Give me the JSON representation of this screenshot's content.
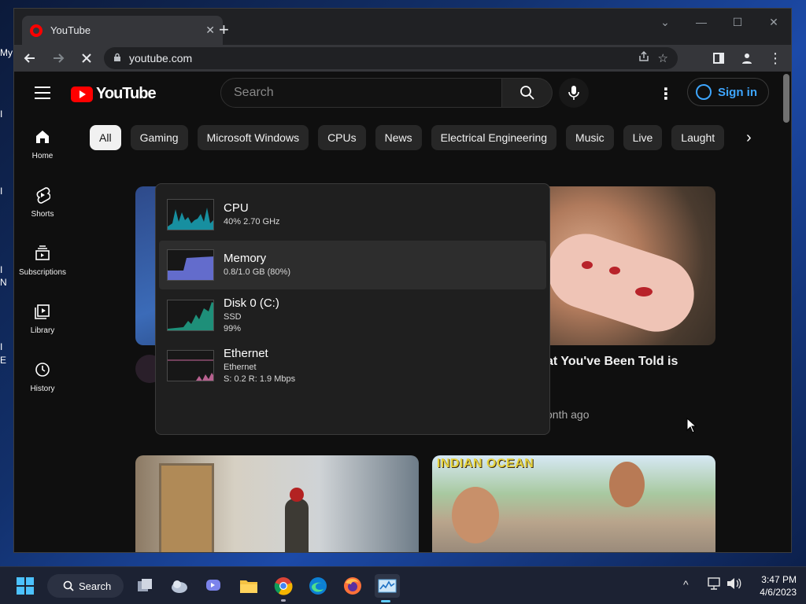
{
  "desktop": {
    "fragments": [
      "My",
      "I",
      "I",
      "I",
      "N",
      "I",
      "E"
    ]
  },
  "browser": {
    "tab_title": "YouTube",
    "tab_close": "✕",
    "new_tab": "+",
    "window_controls": [
      "⌄",
      "—",
      "☐",
      "✕"
    ],
    "url": "youtube.com"
  },
  "youtube": {
    "logo_text": "YouTube",
    "search_placeholder": "Search",
    "signin_label": "Sign in",
    "sidebar": [
      {
        "label": "Home",
        "icon": "home-icon"
      },
      {
        "label": "Shorts",
        "icon": "shorts-icon"
      },
      {
        "label": "Subscriptions",
        "icon": "subscriptions-icon"
      },
      {
        "label": "Library",
        "icon": "library-icon"
      },
      {
        "label": "History",
        "icon": "history-icon"
      }
    ],
    "chips": [
      "All",
      "Gaming",
      "Microsoft Windows",
      "CPUs",
      "News",
      "Electrical Engineering",
      "Music",
      "Live",
      "Laught"
    ],
    "active_chip": "All",
    "videos": [
      {
        "title_fragment": "at You've Been Told is",
        "meta_fragment": "onth ago"
      }
    ],
    "thumbnail_caption": "INDIAN OCEAN"
  },
  "perf_widget": {
    "items": [
      {
        "title": "CPU",
        "lines": [
          "40% 2.70 GHz"
        ],
        "color": "#17a5b8",
        "selected": false
      },
      {
        "title": "Memory",
        "lines": [
          "0.8/1.0 GB (80%)"
        ],
        "color": "#6b76e0",
        "selected": true
      },
      {
        "title": "Disk 0 (C:)",
        "lines": [
          "SSD",
          "99%"
        ],
        "color": "#1f9c84",
        "selected": false
      },
      {
        "title": "Ethernet",
        "lines": [
          "Ethernet",
          "S: 0.2  R: 1.9 Mbps"
        ],
        "color": "#c9699c",
        "selected": false
      }
    ]
  },
  "taskbar": {
    "search_label": "Search",
    "apps": [
      "start-icon",
      "task-view-icon",
      "widgets-icon",
      "teams-chat-icon",
      "file-explorer-icon",
      "chrome-icon",
      "edge-icon",
      "firefox-icon",
      "task-manager-icon"
    ],
    "time": "3:47 PM",
    "date": "4/6/2023"
  },
  "colors": {
    "youtube_red": "#ff0000",
    "signin_blue": "#3ea6ff",
    "taskbar_accent": "#60cdff"
  }
}
